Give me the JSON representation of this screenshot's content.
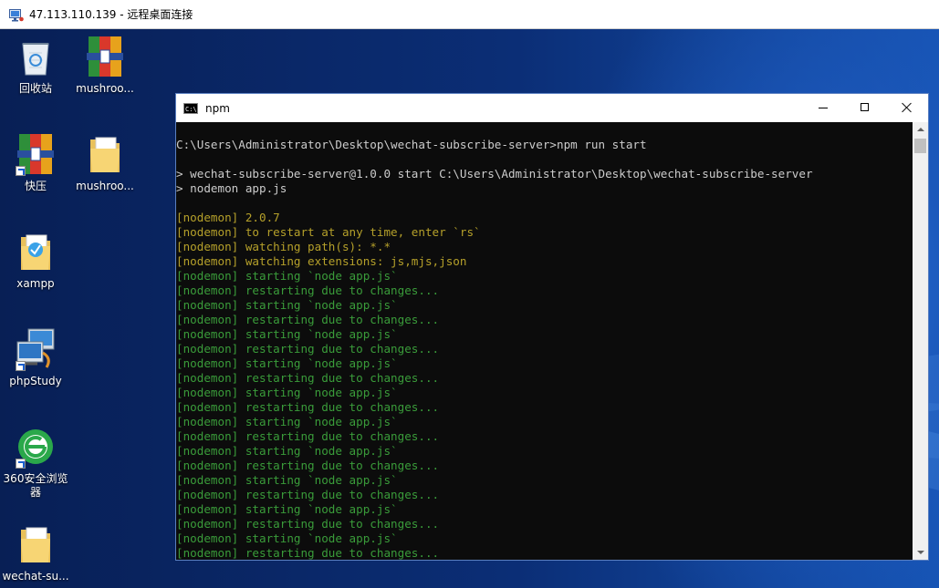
{
  "rdp_window": {
    "title": "47.113.110.139 - 远程桌面连接"
  },
  "desktop": {
    "icons": [
      {
        "label": "回收站",
        "icon": "recycle-bin-icon"
      },
      {
        "label": "mushroo...",
        "icon": "rar-archive-icon"
      },
      {
        "label": "快压",
        "icon": "kuaiya-app-icon"
      },
      {
        "label": "mushroo...",
        "icon": "folder-icon"
      },
      {
        "label": "xampp",
        "icon": "xampp-folder-icon"
      },
      {
        "label": "phpStudy",
        "icon": "phpstudy-icon"
      },
      {
        "label": "360安全浏览器",
        "icon": "360-browser-icon"
      },
      {
        "label": "wechat-su...",
        "icon": "folder-icon"
      }
    ]
  },
  "console": {
    "title": "npm",
    "lines": [
      {
        "text": "C:\\Users\\Administrator\\Desktop\\wechat-subscribe-server>npm run start",
        "color": "white"
      },
      {
        "text": "",
        "color": "gap"
      },
      {
        "text": "> wechat-subscribe-server@1.0.0 start C:\\Users\\Administrator\\Desktop\\wechat-subscribe-server",
        "color": "white"
      },
      {
        "text": "> nodemon app.js",
        "color": "white"
      },
      {
        "text": "",
        "color": "gap"
      },
      {
        "text": "[nodemon] 2.0.7",
        "color": "yellow"
      },
      {
        "text": "[nodemon] to restart at any time, enter `rs`",
        "color": "yellow"
      },
      {
        "text": "[nodemon] watching path(s): *.*",
        "color": "yellow"
      },
      {
        "text": "[nodemon] watching extensions: js,mjs,json",
        "color": "yellow"
      },
      {
        "text": "[nodemon] starting `node app.js`",
        "color": "green"
      },
      {
        "text": "[nodemon] restarting due to changes...",
        "color": "green"
      },
      {
        "text": "[nodemon] starting `node app.js`",
        "color": "green"
      },
      {
        "text": "[nodemon] restarting due to changes...",
        "color": "green"
      },
      {
        "text": "[nodemon] starting `node app.js`",
        "color": "green"
      },
      {
        "text": "[nodemon] restarting due to changes...",
        "color": "green"
      },
      {
        "text": "[nodemon] starting `node app.js`",
        "color": "green"
      },
      {
        "text": "[nodemon] restarting due to changes...",
        "color": "green"
      },
      {
        "text": "[nodemon] starting `node app.js`",
        "color": "green"
      },
      {
        "text": "[nodemon] restarting due to changes...",
        "color": "green"
      },
      {
        "text": "[nodemon] starting `node app.js`",
        "color": "green"
      },
      {
        "text": "[nodemon] restarting due to changes...",
        "color": "green"
      },
      {
        "text": "[nodemon] starting `node app.js`",
        "color": "green"
      },
      {
        "text": "[nodemon] restarting due to changes...",
        "color": "green"
      },
      {
        "text": "[nodemon] starting `node app.js`",
        "color": "green"
      },
      {
        "text": "[nodemon] restarting due to changes...",
        "color": "green"
      },
      {
        "text": "[nodemon] starting `node app.js`",
        "color": "green"
      },
      {
        "text": "[nodemon] restarting due to changes...",
        "color": "green"
      },
      {
        "text": "[nodemon] starting `node app.js`",
        "color": "green"
      },
      {
        "text": "[nodemon] restarting due to changes...",
        "color": "green"
      }
    ]
  },
  "colors": {
    "terminal_bg": "#0c0c0c",
    "terminal_text": "#cccccc",
    "nodemon_yellow": "#b5a02a",
    "nodemon_green": "#3a9c3a"
  }
}
